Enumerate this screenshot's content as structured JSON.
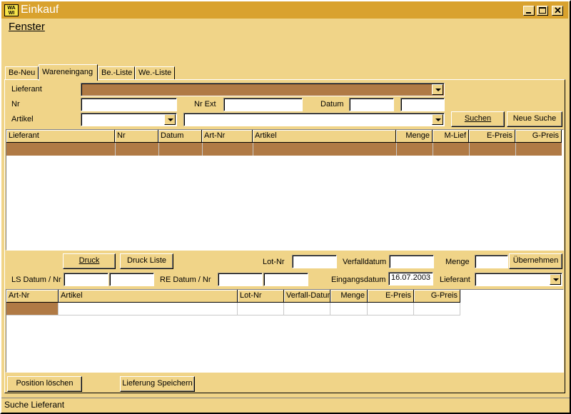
{
  "window": {
    "title": "Einkauf",
    "icon_text": "WA WI"
  },
  "menu": {
    "items": [
      {
        "label": "Fenster"
      }
    ]
  },
  "tabs": [
    {
      "label": "Be-Neu"
    },
    {
      "label": "Wareneingang"
    },
    {
      "label": "Be.-Liste"
    },
    {
      "label": "We.-Liste"
    }
  ],
  "search": {
    "lieferant_label": "Lieferant",
    "nr_label": "Nr",
    "nr_ext_label": "Nr Ext",
    "datum_label": "Datum",
    "artikel_label": "Artikel",
    "suchen_button": "Suchen",
    "neue_suche_button": "Neue Suche"
  },
  "orders_table": {
    "columns": [
      "Lieferant",
      "Nr",
      "Datum",
      "Art-Nr",
      "Artikel",
      "Menge",
      "M-Lief",
      "E-Preis",
      "G-Preis"
    ]
  },
  "entry": {
    "druck_button": "Druck",
    "druck_liste_button": "Druck Liste",
    "lot_nr_label": "Lot-Nr",
    "verfalldatum_label": "Verfalldatum",
    "menge_label": "Menge",
    "uebernehmen_button": "Übernehmen",
    "ls_label": "LS Datum / Nr",
    "re_label": "RE Datum / Nr",
    "eingangsdatum_label": "Eingangsdatum",
    "eingangsdatum_value": "16.07.2003",
    "lieferant_label": "Lieferant"
  },
  "positions_table": {
    "columns": [
      "Art-Nr",
      "Artikel",
      "Lot-Nr",
      "Verfall-Datum",
      "Menge",
      "E-Preis",
      "G-Preis"
    ]
  },
  "footer": {
    "position_loeschen_button": "Position löschen",
    "lieferung_speichern_button": "Lieferung Speichern"
  },
  "status": {
    "text": "Suche Lieferant"
  },
  "colors": {
    "background": "#f0d488",
    "titlebar": "#d9a22e",
    "selection": "#b07a45"
  }
}
